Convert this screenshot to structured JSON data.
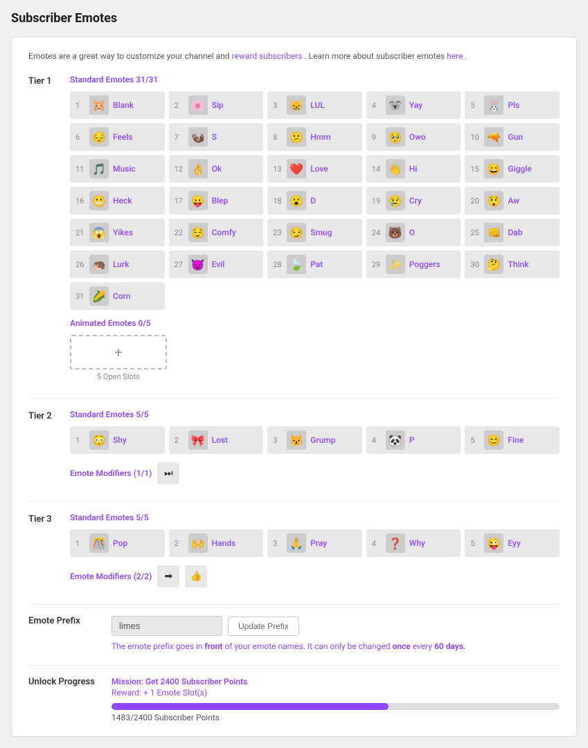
{
  "page": {
    "title": "Subscriber Emotes"
  },
  "info": {
    "text_before": "Emotes are a great way to customize your channel and ",
    "link1_text": "reward subscribers",
    "text_middle": ". Learn more about subscriber emotes ",
    "link2_text": "here",
    "text_after": "."
  },
  "tier1": {
    "label": "Tier 1",
    "standard_title": "Standard Emotes 31/31",
    "animated_title": "Animated Emotes 0/5",
    "open_slots": "5 Open Slots",
    "add_icon": "+",
    "emotes": [
      {
        "num": 1,
        "name": "Blank",
        "cls": "e1"
      },
      {
        "num": 2,
        "name": "Sip",
        "cls": "e2"
      },
      {
        "num": 3,
        "name": "LUL",
        "cls": "e3"
      },
      {
        "num": 4,
        "name": "Yay",
        "cls": "e4"
      },
      {
        "num": 5,
        "name": "Pls",
        "cls": "e5"
      },
      {
        "num": 6,
        "name": "Feels",
        "cls": "e6"
      },
      {
        "num": 7,
        "name": "S",
        "cls": "e7"
      },
      {
        "num": 8,
        "name": "Hmm",
        "cls": "e8"
      },
      {
        "num": 9,
        "name": "Owo",
        "cls": "e9"
      },
      {
        "num": 10,
        "name": "Gun",
        "cls": "e10"
      },
      {
        "num": 11,
        "name": "Music",
        "cls": "e11"
      },
      {
        "num": 12,
        "name": "Ok",
        "cls": "e12"
      },
      {
        "num": 13,
        "name": "Love",
        "cls": "e13"
      },
      {
        "num": 14,
        "name": "Hi",
        "cls": "e14"
      },
      {
        "num": 15,
        "name": "Giggle",
        "cls": "e15"
      },
      {
        "num": 16,
        "name": "Heck",
        "cls": "e16"
      },
      {
        "num": 17,
        "name": "Blep",
        "cls": "e17"
      },
      {
        "num": 18,
        "name": "D",
        "cls": "e18"
      },
      {
        "num": 19,
        "name": "Cry",
        "cls": "e19"
      },
      {
        "num": 20,
        "name": "Aw",
        "cls": "e20"
      },
      {
        "num": 21,
        "name": "Yikes",
        "cls": "e21"
      },
      {
        "num": 22,
        "name": "Comfy",
        "cls": "e22"
      },
      {
        "num": 23,
        "name": "Smug",
        "cls": "e23"
      },
      {
        "num": 24,
        "name": "O",
        "cls": "e24"
      },
      {
        "num": 25,
        "name": "Dab",
        "cls": "e25"
      },
      {
        "num": 26,
        "name": "Lurk",
        "cls": "e26"
      },
      {
        "num": 27,
        "name": "Evil",
        "cls": "e27"
      },
      {
        "num": 28,
        "name": "Pat",
        "cls": "e28"
      },
      {
        "num": 29,
        "name": "Poggers",
        "cls": "e29"
      },
      {
        "num": 30,
        "name": "Think",
        "cls": "e30"
      },
      {
        "num": 31,
        "name": "Corn",
        "cls": "e31"
      }
    ]
  },
  "tier2": {
    "label": "Tier 2",
    "standard_title": "Standard Emotes 5/5",
    "modifiers_title": "Emote Modifiers (1/1)",
    "emotes": [
      {
        "num": 1,
        "name": "Shy",
        "cls": "t2e1"
      },
      {
        "num": 2,
        "name": "Lost",
        "cls": "t2e2"
      },
      {
        "num": 3,
        "name": "Grump",
        "cls": "t2e3"
      },
      {
        "num": 4,
        "name": "P",
        "cls": "t2e4"
      },
      {
        "num": 5,
        "name": "Fine",
        "cls": "t2e5"
      }
    ],
    "modifier_icon_cls": "mod1"
  },
  "tier3": {
    "label": "Tier 3",
    "standard_title": "Standard Emotes 5/5",
    "modifiers_title": "Emote Modifiers (2/2)",
    "emotes": [
      {
        "num": 1,
        "name": "Pop",
        "cls": "t3e1"
      },
      {
        "num": 2,
        "name": "Hands",
        "cls": "t3e2"
      },
      {
        "num": 3,
        "name": "Pray",
        "cls": "t3e3"
      },
      {
        "num": 4,
        "name": "Why",
        "cls": "t3e4"
      },
      {
        "num": 5,
        "name": "Eyy",
        "cls": "t3e5"
      }
    ],
    "modifier_icons": [
      "mod2",
      "mod3"
    ]
  },
  "emote_prefix": {
    "section_label": "Emote Prefix",
    "input_value": "limes",
    "button_label": "Update Prefix",
    "note": "The emote prefix goes in front of your emote names. It can only be changed once every 60 days."
  },
  "unlock": {
    "label": "Unlock Progress",
    "mission": "Mission: Get 2400 Subscriber Points",
    "reward": "Reward: + 1 Emote Slot(s)",
    "progress_current": 1483,
    "progress_max": 2400,
    "progress_label": "1483/2400 Subscriber Points",
    "progress_pct": 61.8
  }
}
